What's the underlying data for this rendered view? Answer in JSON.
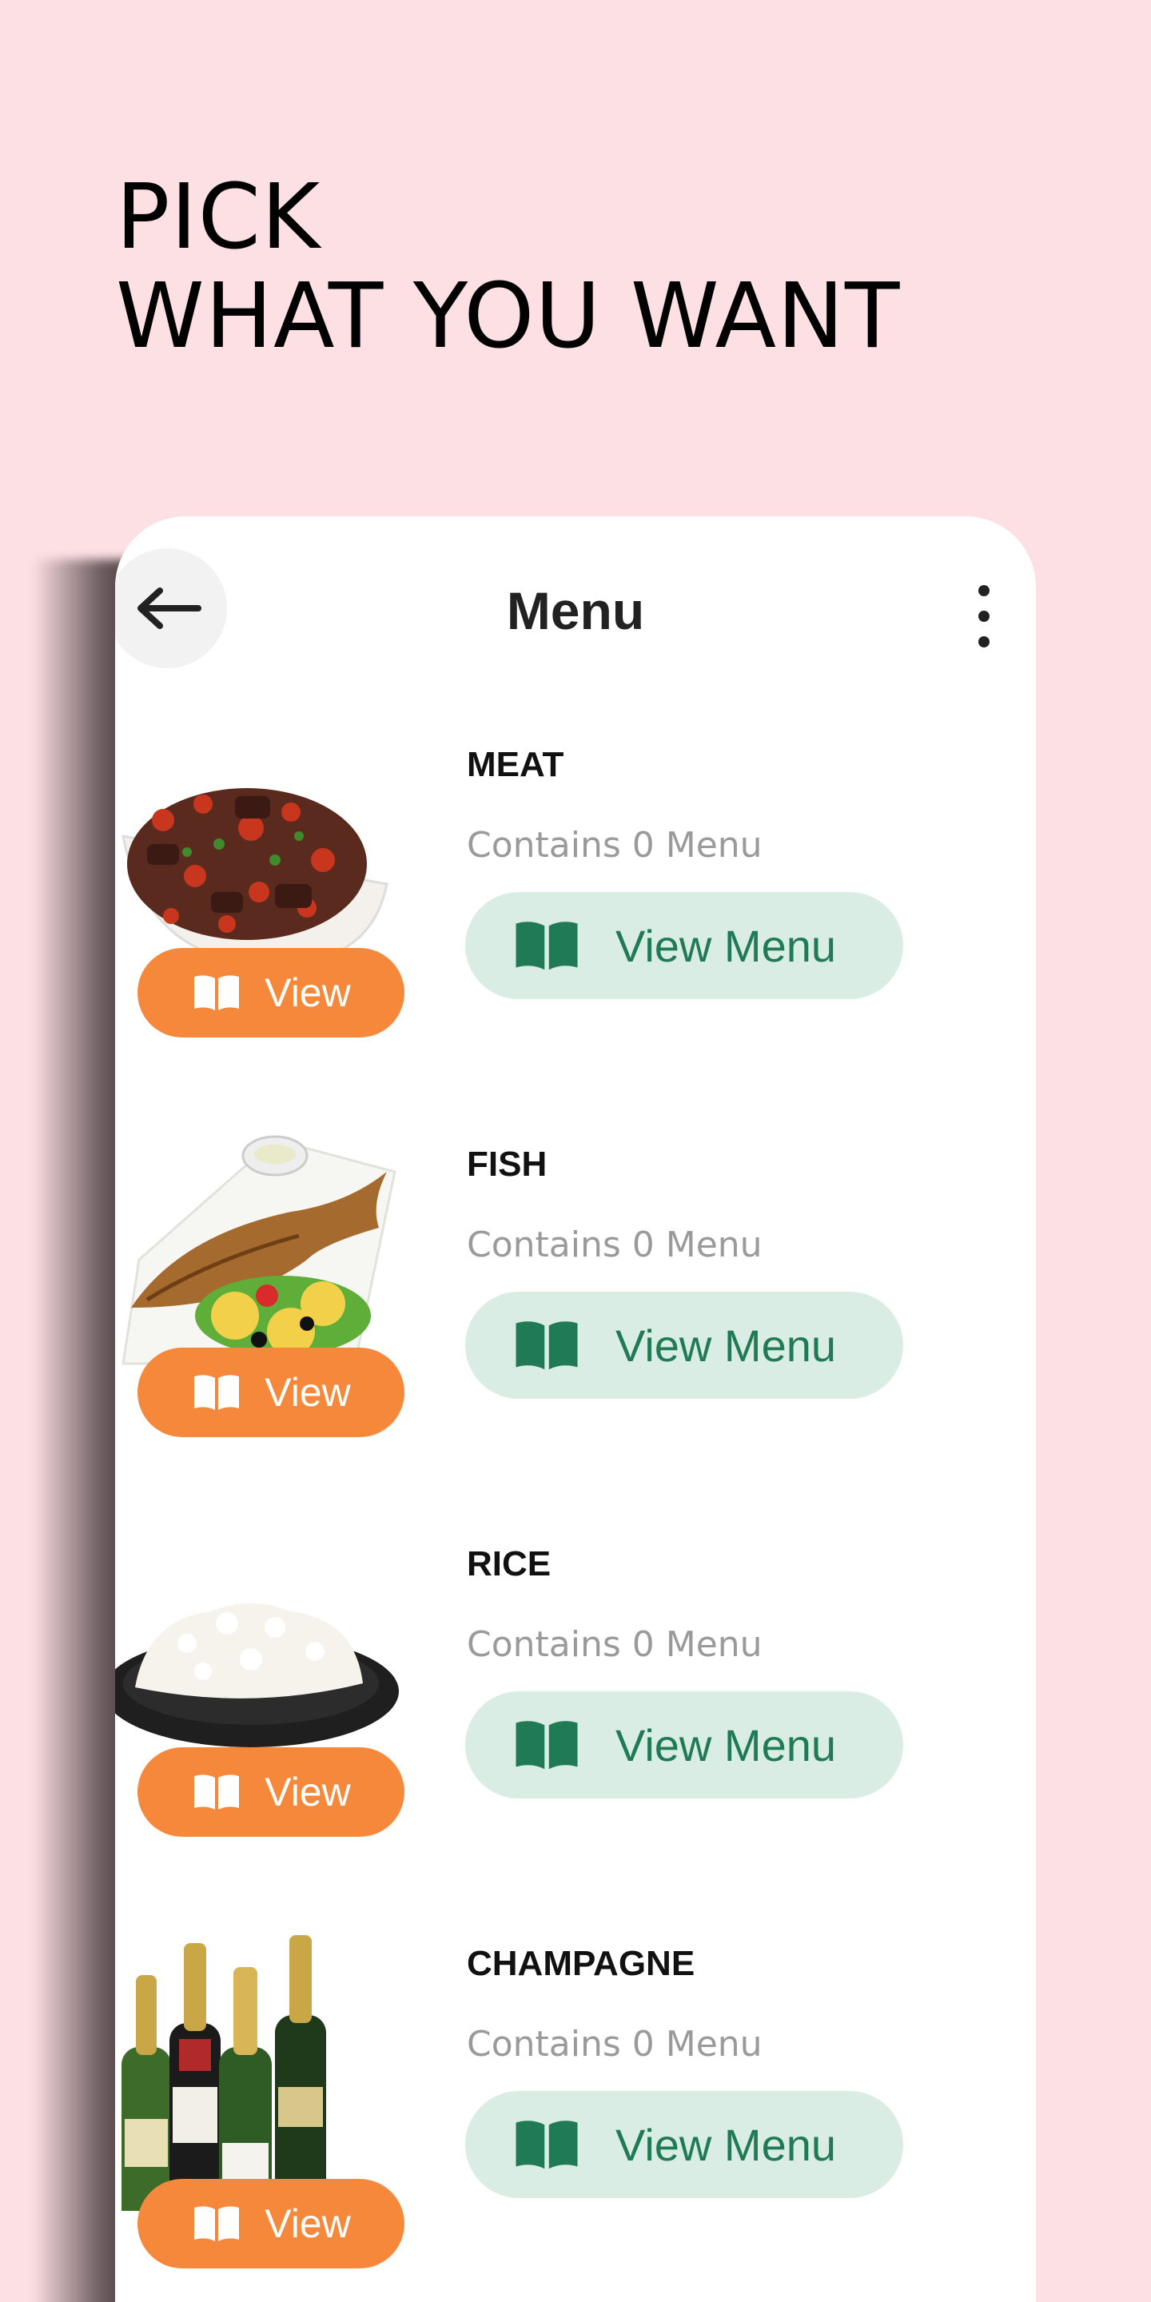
{
  "headline": {
    "line1": "PICK",
    "line2": "WHAT YOU WANT"
  },
  "header": {
    "title": "Menu",
    "back_icon": "arrow-left-icon",
    "more_icon": "more-vertical-icon"
  },
  "colors": {
    "background": "#fde0e4",
    "view_button": "#f5883a",
    "view_menu_bg": "#d9ede4",
    "view_menu_text": "#1f7a55"
  },
  "categories": [
    {
      "title": "MEAT",
      "subtitle": "Contains 0 Menu",
      "view_label": "View",
      "view_menu_label": "View Menu",
      "image": "meat-dish"
    },
    {
      "title": "FISH",
      "subtitle": "Contains 0 Menu",
      "view_label": "View",
      "view_menu_label": "View Menu",
      "image": "grilled-fish"
    },
    {
      "title": "RICE",
      "subtitle": "Contains 0 Menu",
      "view_label": "View",
      "view_menu_label": "View Menu",
      "image": "rice-plate"
    },
    {
      "title": "CHAMPAGNE",
      "subtitle": "Contains 0 Menu",
      "view_label": "View",
      "view_menu_label": "View Menu",
      "image": "champagne-bottles"
    }
  ]
}
